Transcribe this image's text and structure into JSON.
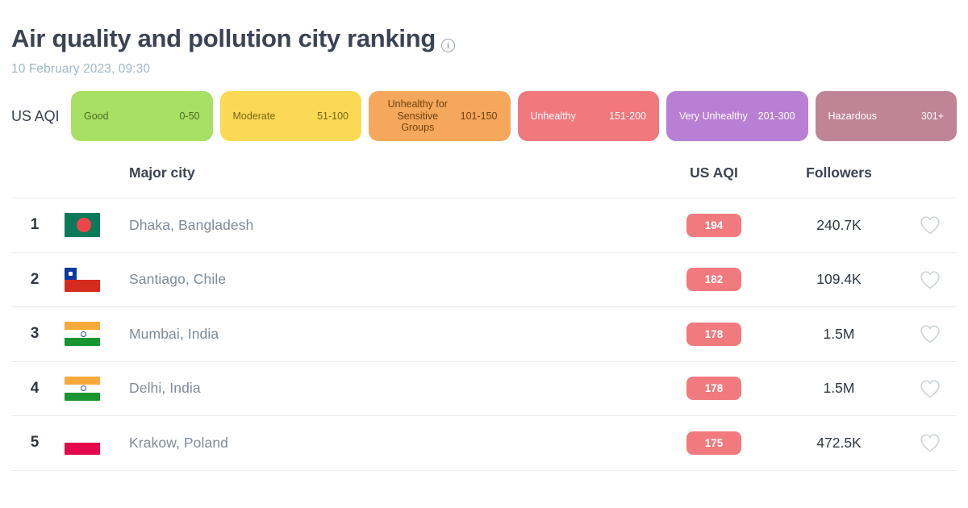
{
  "header": {
    "title": "Air quality and pollution city ranking",
    "info_icon": "info-icon",
    "timestamp": "10 February 2023, 09:30"
  },
  "legend": {
    "label": "US AQI",
    "items": [
      {
        "name": "Good",
        "range": "0-50",
        "bg": "#a8df65",
        "fg": "#4a6b1f"
      },
      {
        "name": "Moderate",
        "range": "51-100",
        "bg": "#fada54",
        "fg": "#7a6312"
      },
      {
        "name": "Unhealthy for Sensitive Groups",
        "range": "101-150",
        "bg": "#f5a85c",
        "fg": "#6e3f0d"
      },
      {
        "name": "Unhealthy",
        "range": "151-200",
        "bg": "#f1787d",
        "fg": "#ffffff"
      },
      {
        "name": "Very Unhealthy",
        "range": "201-300",
        "bg": "#b97fd4",
        "fg": "#ffffff"
      },
      {
        "name": "Hazardous",
        "range": "301+",
        "bg": "#c08497",
        "fg": "#ffffff"
      }
    ]
  },
  "table": {
    "columns": {
      "city": "Major city",
      "aqi": "US AQI",
      "followers": "Followers"
    },
    "favorite_icon": "heart-icon",
    "rows": [
      {
        "rank": "1",
        "flag": "bangladesh-flag",
        "city": "Dhaka, Bangladesh",
        "aqi": "194",
        "followers": "240.7K"
      },
      {
        "rank": "2",
        "flag": "chile-flag",
        "city": "Santiago, Chile",
        "aqi": "182",
        "followers": "109.4K"
      },
      {
        "rank": "3",
        "flag": "india-flag",
        "city": "Mumbai, India",
        "aqi": "178",
        "followers": "1.5M"
      },
      {
        "rank": "4",
        "flag": "india-flag",
        "city": "Delhi, India",
        "aqi": "178",
        "followers": "1.5M"
      },
      {
        "rank": "5",
        "flag": "poland-flag",
        "city": "Krakow, Poland",
        "aqi": "175",
        "followers": "472.5K"
      }
    ]
  },
  "colors": {
    "aqi_badge_bg": "#f17a7e",
    "title": "#3b4453",
    "timestamp": "#9fb6c9",
    "city_text": "#7e8b98",
    "row_divider": "#e9edf1"
  }
}
